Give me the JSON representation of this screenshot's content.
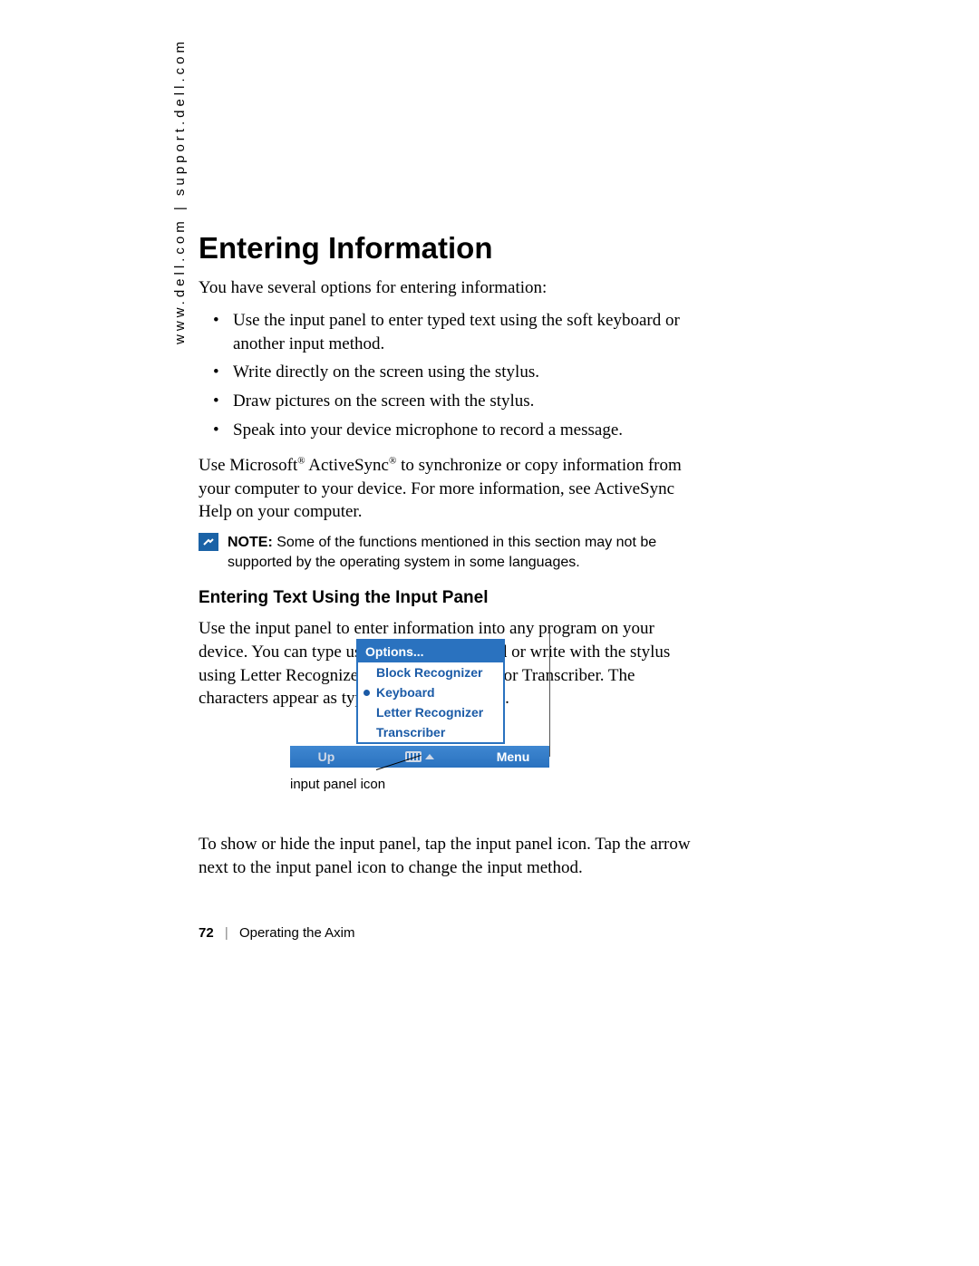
{
  "side_url": "www.dell.com | support.dell.com",
  "heading": "Entering Information",
  "intro": "You have several options for entering information:",
  "bullets": [
    "Use the input panel to enter typed text using the soft keyboard or another input method.",
    "Write directly on the screen using the stylus.",
    "Draw pictures on the screen with the stylus.",
    "Speak into your device microphone to record a message."
  ],
  "sync_para_pre": "Use Microsoft",
  "sync_para_mid": " ActiveSync",
  "sync_para_post": " to synchronize or copy information from your computer to your device. For more information, see ActiveSync Help on your computer.",
  "note_label": "NOTE:",
  "note_text": " Some of the functions mentioned in this section may not be supported by the operating system in some languages.",
  "subheading": "Entering Text Using the Input Panel",
  "sub_para": "Use the input panel to enter information into any program on your device. You can type using the soft keyboard or write with the stylus using Letter Recognizer, Block Recognizer, or Transcriber. The characters appear as typed text on the screen.",
  "popup": {
    "header": "Options...",
    "items": [
      "Block Recognizer",
      "Keyboard",
      "Letter Recognizer",
      "Transcriber"
    ],
    "selected_index": 1
  },
  "bar": {
    "left": "Up",
    "right": "Menu"
  },
  "callout": "input panel icon",
  "after_para": "To show or hide the input panel, tap the input panel icon. Tap the arrow next to the input panel icon to change the input method.",
  "footer": {
    "page": "72",
    "divider": "|",
    "title": "Operating the Axim"
  }
}
